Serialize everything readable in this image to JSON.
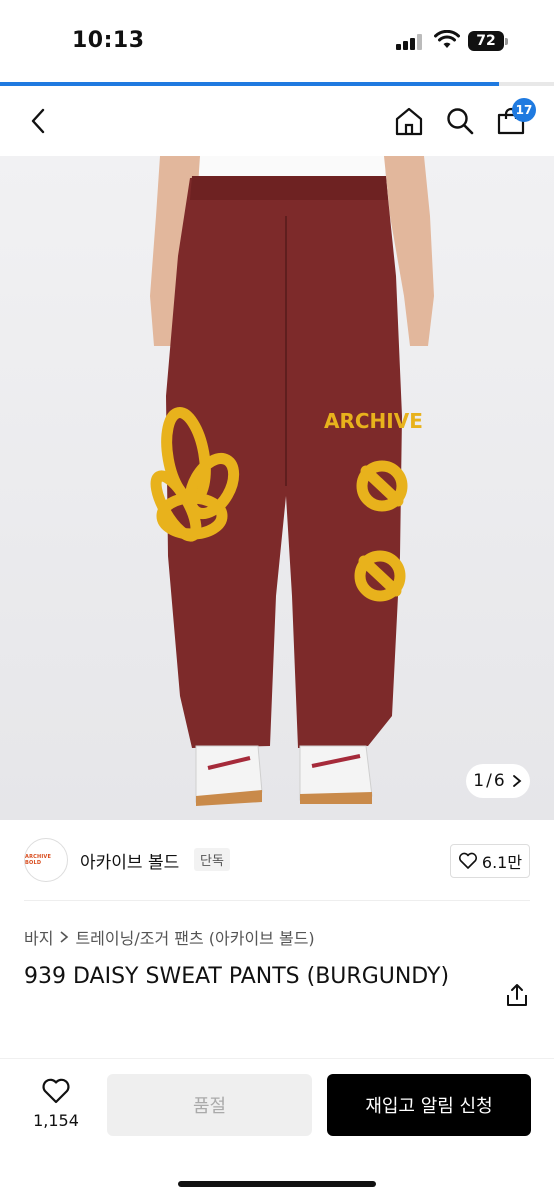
{
  "status_bar": {
    "time": "10:13",
    "battery": "72"
  },
  "nav": {
    "back_icon": "chevron-left-icon",
    "home_icon": "home-icon",
    "search_icon": "search-icon",
    "cart_icon": "bag-icon",
    "cart_count": "17"
  },
  "page_progress": 0.9,
  "product_image": {
    "counter_current": "1",
    "counter_sep": "/",
    "counter_total": "6",
    "print_text": "ARCHIVE",
    "colors": {
      "pants": "#7d2a2a",
      "print": "#e8b21c"
    }
  },
  "brand": {
    "logo_text": "ARCHIVE BOLD",
    "name": "아카이브 볼드",
    "tag": "단독",
    "likes": "6.1만"
  },
  "breadcrumb": {
    "category": "바지",
    "sub_category": "트레이닝/조거 팬츠 (아카이브 볼드)"
  },
  "product": {
    "title": "939 DAISY SWEAT PANTS (BURGUNDY)"
  },
  "bottom_bar": {
    "wish_count": "1,154",
    "sold_out_label": "품절",
    "restock_label": "재입고 알림 신청"
  },
  "accent_color": "#1f7ae0"
}
